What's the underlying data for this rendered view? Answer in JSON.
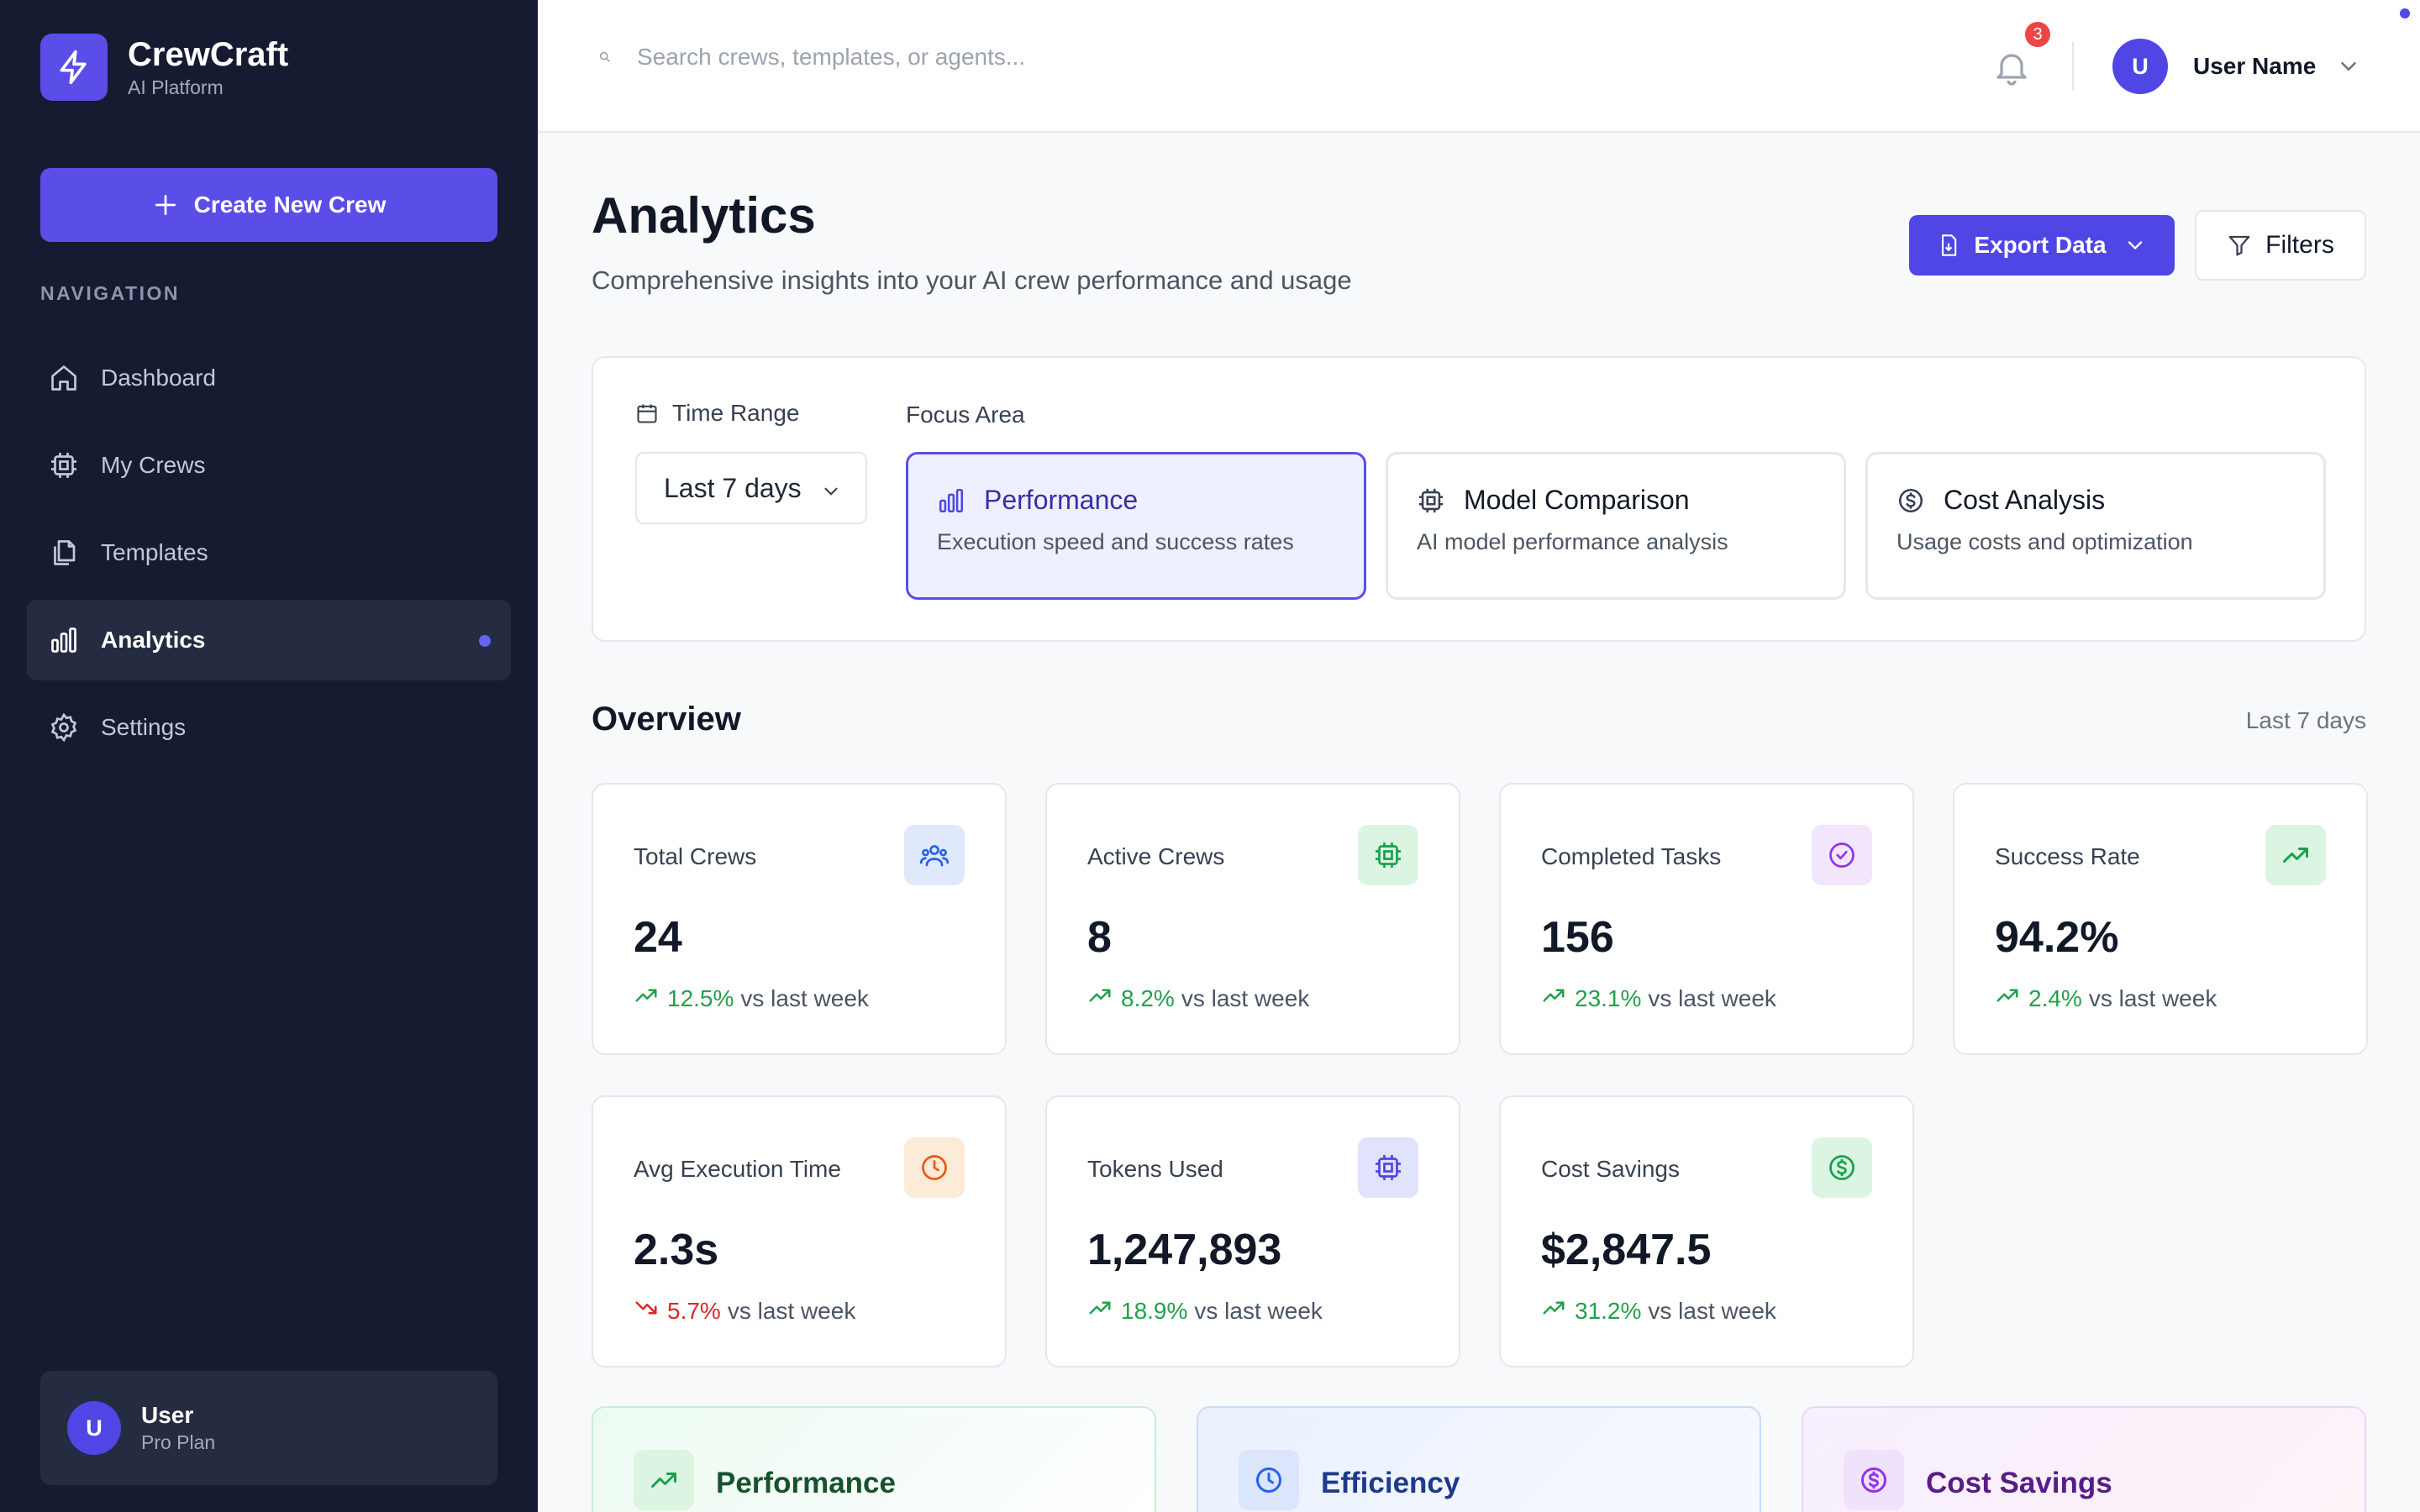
{
  "app": {
    "name": "CrewCraft",
    "subtitle": "AI Platform"
  },
  "sidebar": {
    "create_button": "Create New Crew",
    "nav_heading": "NAVIGATION",
    "items": [
      {
        "label": "Dashboard",
        "icon": "home-icon"
      },
      {
        "label": "My Crews",
        "icon": "cpu-icon"
      },
      {
        "label": "Templates",
        "icon": "copy-icon"
      },
      {
        "label": "Analytics",
        "icon": "bar-chart-icon",
        "active": true
      },
      {
        "label": "Settings",
        "icon": "gear-icon"
      }
    ],
    "user": {
      "initial": "U",
      "name": "User",
      "plan": "Pro Plan"
    }
  },
  "topbar": {
    "search_placeholder": "Search crews, templates, or agents...",
    "notification_count": "3",
    "user_initial": "U",
    "user_name": "User Name"
  },
  "page": {
    "title": "Analytics",
    "subtitle": "Comprehensive insights into your AI crew performance and usage",
    "export_button": "Export Data",
    "filters_button": "Filters"
  },
  "controls": {
    "time_range_label": "Time Range",
    "time_range_value": "Last 7 days",
    "focus_area_label": "Focus Area",
    "focus_options": [
      {
        "title": "Performance",
        "description": "Execution speed and success rates",
        "selected": true
      },
      {
        "title": "Model Comparison",
        "description": "AI model performance analysis",
        "selected": false
      },
      {
        "title": "Cost Analysis",
        "description": "Usage costs and optimization",
        "selected": false
      }
    ]
  },
  "overview": {
    "title": "Overview",
    "range": "Last 7 days",
    "stats": [
      {
        "label": "Total Crews",
        "value": "24",
        "change": "12.5%",
        "trend": "up",
        "suffix": "vs last week",
        "icon": "users-icon",
        "icon_color": "#2563eb",
        "icon_bg": "#e0e9fb"
      },
      {
        "label": "Active Crews",
        "value": "8",
        "change": "8.2%",
        "trend": "up",
        "suffix": "vs last week",
        "icon": "cpu-icon",
        "icon_color": "#16a34a",
        "icon_bg": "#dcf5e3"
      },
      {
        "label": "Completed Tasks",
        "value": "156",
        "change": "23.1%",
        "trend": "up",
        "suffix": "vs last week",
        "icon": "check-circle-icon",
        "icon_color": "#9333ea",
        "icon_bg": "#f1e6fb"
      },
      {
        "label": "Success Rate",
        "value": "94.2%",
        "change": "2.4%",
        "trend": "up",
        "suffix": "vs last week",
        "icon": "trending-up-icon",
        "icon_color": "#16a34a",
        "icon_bg": "#dcf5e3"
      },
      {
        "label": "Avg Execution Time",
        "value": "2.3s",
        "change": "5.7%",
        "trend": "down",
        "suffix": "vs last week",
        "icon": "clock-icon",
        "icon_color": "#ea580c",
        "icon_bg": "#fdebd9"
      },
      {
        "label": "Tokens Used",
        "value": "1,247,893",
        "change": "18.9%",
        "trend": "up",
        "suffix": "vs last week",
        "icon": "cpu-icon",
        "icon_color": "#4f46e5",
        "icon_bg": "#e0e3fb"
      },
      {
        "label": "Cost Savings",
        "value": "$2,847.5",
        "change": "31.2%",
        "trend": "up",
        "suffix": "vs last week",
        "icon": "dollar-icon",
        "icon_color": "#16a34a",
        "icon_bg": "#dcf5e3"
      }
    ]
  },
  "categories": [
    {
      "title": "Performance",
      "icon": "trending-up-icon",
      "title_color": "#14532d"
    },
    {
      "title": "Efficiency",
      "icon": "clock-icon",
      "title_color": "#1e3a8a"
    },
    {
      "title": "Cost Savings",
      "icon": "dollar-icon",
      "title_color": "#581c87"
    }
  ]
}
